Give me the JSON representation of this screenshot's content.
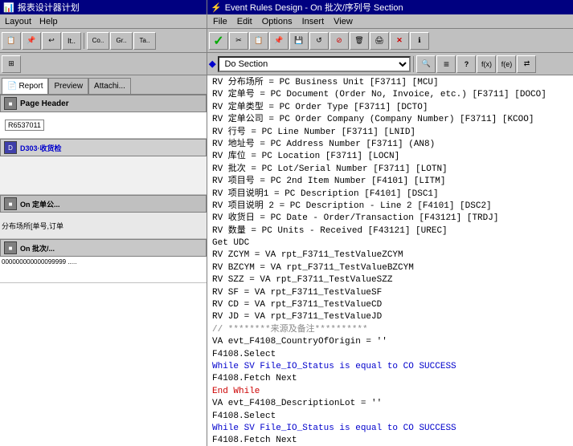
{
  "left": {
    "title": "报表设计器计划",
    "menu": [
      "Layout",
      "Help"
    ],
    "toolbar1": [
      "Copy",
      "Paste",
      "Undo",
      "It...",
      "Co...",
      "Gr...",
      "Ta..."
    ],
    "tabs": [
      "Report",
      "Preview",
      "Attachi..."
    ],
    "sections": {
      "pageHeader": {
        "label": "Page Header",
        "field": "R6537011"
      },
      "d303": {
        "label": "D303·收货检",
        "content": ""
      },
      "onDingdan": {
        "label": "On 定单公...",
        "content": "分布场所[单号,订单"
      },
      "onPici": {
        "label": "On 批次/...",
        "content": "000000000000099999 ....."
      }
    }
  },
  "right": {
    "title": "Event Rules Design - On 批次/序列号 Section",
    "menu": [
      "File",
      "Edit",
      "Options",
      "Insert",
      "View"
    ],
    "section_selector": "Do Section",
    "toolbar_icons": [
      "check",
      "scissors",
      "copy",
      "paste",
      "disk",
      "refresh",
      "stop",
      "trash",
      "print",
      "x-red",
      "info"
    ],
    "toolbar2_icons": [
      "diamond",
      "equals",
      "question",
      "f1",
      "f2",
      "arrows"
    ],
    "code_lines": [
      {
        "text": "RV 分布场所 = PC Business Unit [F3711] [MCU]",
        "style": "black"
      },
      {
        "text": "RV 定单号 = PC Document (Order No, Invoice, etc.) [F3711] [DOCO]",
        "style": "black"
      },
      {
        "text": "RV 定单类型 = PC Order Type [F3711] [DCTO]",
        "style": "black"
      },
      {
        "text": "RV 定单公司 = PC Order Company (Company Number) [F3711] [KCOO]",
        "style": "black"
      },
      {
        "text": "RV 行号 = PC Line Number [F3711] [LNID]",
        "style": "black"
      },
      {
        "text": "RV 地址号 = PC Address Number [F3711] (AN8)",
        "style": "black"
      },
      {
        "text": "RV 库位 = PC Location [F3711] [LOCN]",
        "style": "black"
      },
      {
        "text": "RV 批次 = PC Lot/Serial Number [F3711] [LOTN]",
        "style": "black"
      },
      {
        "text": "RV 项目号 = PC 2nd Item Number [F4101] [LITM]",
        "style": "black"
      },
      {
        "text": "RV 项目说明1 = PC Description [F4101] [DSC1]",
        "style": "black"
      },
      {
        "text": "RV 项目说明 2 = PC Description - Line 2 [F4101] [DSC2]",
        "style": "black"
      },
      {
        "text": "RV 收货日 = PC Date - Order/Transaction [F43121] [TRDJ]",
        "style": "black"
      },
      {
        "text": "RV 数量 = PC Units - Received [F43121] [UREC]",
        "style": "black"
      },
      {
        "text": "Get UDC",
        "style": "black"
      },
      {
        "text": "RV ZCYM = VA rpt_F3711_TestValueZCYM",
        "style": "black"
      },
      {
        "text": "RV BZCYM = VA rpt_F3711_TestValueBZCYM",
        "style": "black"
      },
      {
        "text": "RV SZZ = VA rpt_F3711_TestValueSZZ",
        "style": "black"
      },
      {
        "text": "RV SF = VA rpt_F3711_TestValueSF",
        "style": "black"
      },
      {
        "text": "RV CD = VA rpt_F3711_TestValueCD",
        "style": "black"
      },
      {
        "text": "RV JD = VA rpt_F3711_TestValueJD",
        "style": "black"
      },
      {
        "text": "// ********来源及备注**********",
        "style": "comment"
      },
      {
        "text": "VA evt_F4108_CountryOfOrigin = ''",
        "style": "black"
      },
      {
        "text": "F4108.Select",
        "style": "black"
      },
      {
        "text": "While SV File_IO_Status is equal to CO SUCCESS",
        "style": "blue"
      },
      {
        "text": "    F4108.Fetch Next",
        "style": "black"
      },
      {
        "text": "End While",
        "style": "red"
      },
      {
        "text": "VA evt_F4108_DescriptionLot = ''",
        "style": "black"
      },
      {
        "text": "F4108.Select",
        "style": "black"
      },
      {
        "text": "While SV File_IO_Status is equal to CO SUCCESS",
        "style": "blue"
      },
      {
        "text": "    F4108.Fetch Next",
        "style": "black"
      }
    ]
  }
}
